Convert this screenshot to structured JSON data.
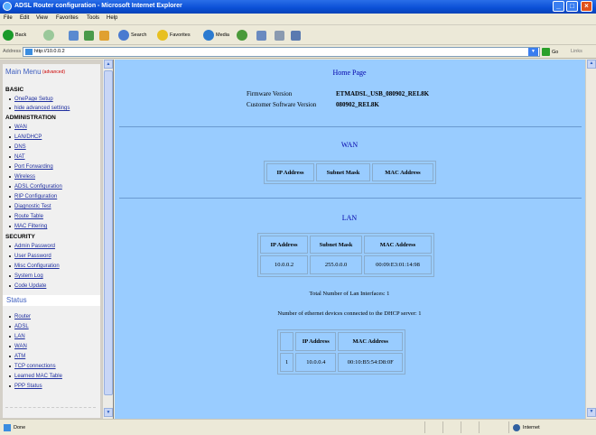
{
  "window": {
    "title": "ADSL Router configuration - Microsoft Internet Explorer"
  },
  "menu": [
    "File",
    "Edit",
    "View",
    "Favorites",
    "Tools",
    "Help"
  ],
  "toolbar": {
    "back": "Back",
    "search": "Search",
    "favorites": "Favorites",
    "media": "Media"
  },
  "address": {
    "label": "Address",
    "url": "http://10.0.0.2",
    "go": "Go",
    "links": "Links"
  },
  "sidebar": {
    "title": "Main Menu",
    "advanced_label": "(advanced)",
    "basic": {
      "heading": "BASIC",
      "items": [
        "OnePage Setup",
        "hide advanced settings"
      ]
    },
    "administration": {
      "heading": "ADMINISTRATION",
      "items": [
        "WAN",
        "LAN/DHCP",
        "DNS",
        "NAT",
        "Port Forwarding",
        "Wireless",
        "ADSL Configuration",
        "RIP Configuration",
        "Diagnostic Test",
        "Route Table",
        "MAC Filtering"
      ]
    },
    "security": {
      "heading": "SECURITY",
      "items": [
        "Admin Password",
        "User Password",
        "Misc Configuration",
        "System Log",
        "Code Update"
      ]
    },
    "status": {
      "heading": "Status",
      "items": [
        "Router",
        "ADSL",
        "LAN",
        "WAN",
        "ATM",
        "TCP connections",
        "Learned MAC Table",
        "PPP Status"
      ]
    }
  },
  "home": {
    "title": "Home Page",
    "firmware_label": "Firmware Version",
    "firmware_value": "ETMADSL_USB_080902_REL8K",
    "customer_label": "Customer Software Version",
    "customer_value": "080902_REL8K"
  },
  "wan": {
    "title": "WAN",
    "headers": [
      "IP Address",
      "Subnet Mask",
      "MAC Address"
    ]
  },
  "lan": {
    "title": "LAN",
    "headers": [
      "IP Address",
      "Subnet Mask",
      "MAC Address"
    ],
    "row": [
      "10.0.0.2",
      "255.0.0.0",
      "00:09:E3:01:14:98"
    ],
    "total_interfaces": "Total Number of Lan Interfaces: 1",
    "ethernet_devices": "Number of ethernet devices connected to the DHCP server: 1",
    "dhcp_headers": [
      "IP Address",
      "MAC Address"
    ],
    "dhcp_row": [
      "1",
      "10.0.0.4",
      "00:10:B5:54:D8:0F"
    ]
  },
  "statusbar": {
    "left": "Done",
    "right": "Internet"
  }
}
